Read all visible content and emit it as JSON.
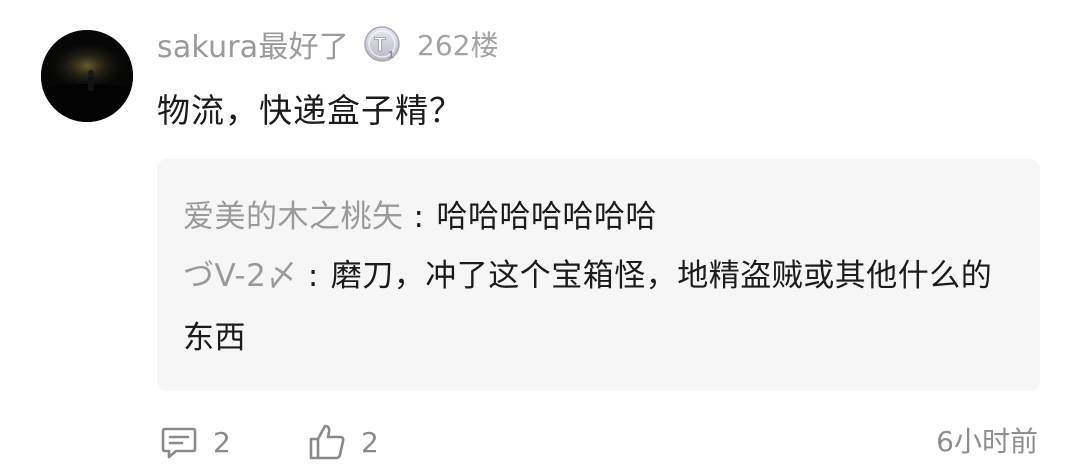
{
  "comment": {
    "username": "sakura最好了",
    "level_badge_letter": "T",
    "level_badge_sub": "1",
    "floor": "262楼",
    "text": "物流，快递盒子精？",
    "time": "6小时前",
    "reply_count": "2",
    "like_count": "2"
  },
  "replies": [
    {
      "author": "爱美的木之桃矢",
      "separator": ":",
      "text": "哈哈哈哈哈哈哈"
    },
    {
      "author": "づV-2〆",
      "separator": ":",
      "text": "磨刀，冲了这个宝箱怪，地精盗贼或其他什么的东西"
    }
  ],
  "icons": {
    "avatar": "user-avatar",
    "badge": "level-badge-icon",
    "reply": "comment-icon",
    "like": "thumbs-up-icon"
  },
  "colors": {
    "username": "#9b9b9b",
    "text": "#1c1c1c",
    "reply_bg": "#f6f6f6",
    "meta": "#8f8f8f"
  }
}
